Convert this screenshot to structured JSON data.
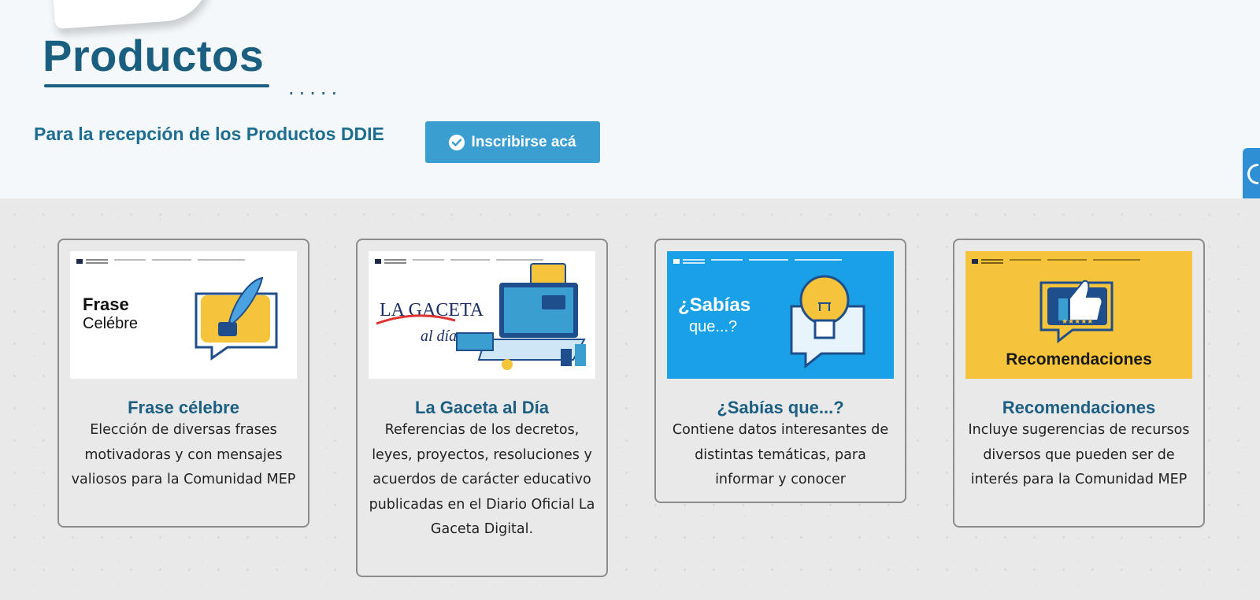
{
  "header": {
    "title": "Productos",
    "dots": ".....",
    "intro_text": "Para la recepción de los Productos DDIE",
    "signup_label": "Inscribirse acá"
  },
  "colors": {
    "brand": "#1a5f80",
    "button": "#3a9ed1",
    "card_border": "#8c8c8c",
    "yellow": "#f6c43a",
    "blue_banner": "#1aa0e6"
  },
  "cards": [
    {
      "title": "Frase célebre",
      "description": "Elección de diversas frases motivadoras y con mensajes valiosos para la Comunidad MEP",
      "banner": {
        "line1": "Frase",
        "line2": "Celébre",
        "icon": "quill-speech-bubble-icon"
      }
    },
    {
      "title": "La Gaceta al Día",
      "description": "Referencias de los decretos, leyes, proyectos, resoluciones y acuerdos de carácter educativo publicadas en el Diario Oficial La Gaceta Digital.",
      "banner": {
        "line1": "LA GACETA",
        "line2": "al día",
        "icon": "laptop-icon"
      }
    },
    {
      "title": "¿Sabías que...?",
      "description": "Contiene datos interesantes de distintas temáticas, para informar y conocer",
      "banner": {
        "line1": "¿Sabías",
        "line2": "que...?",
        "icon": "lightbulb-icon"
      }
    },
    {
      "title": "Recomendaciones",
      "description": "Incluye sugerencias de recursos diversos que pueden ser de interés para la Comunidad MEP",
      "banner": {
        "line1": "Recomendaciones",
        "icon": "thumbs-up-icon"
      }
    }
  ]
}
